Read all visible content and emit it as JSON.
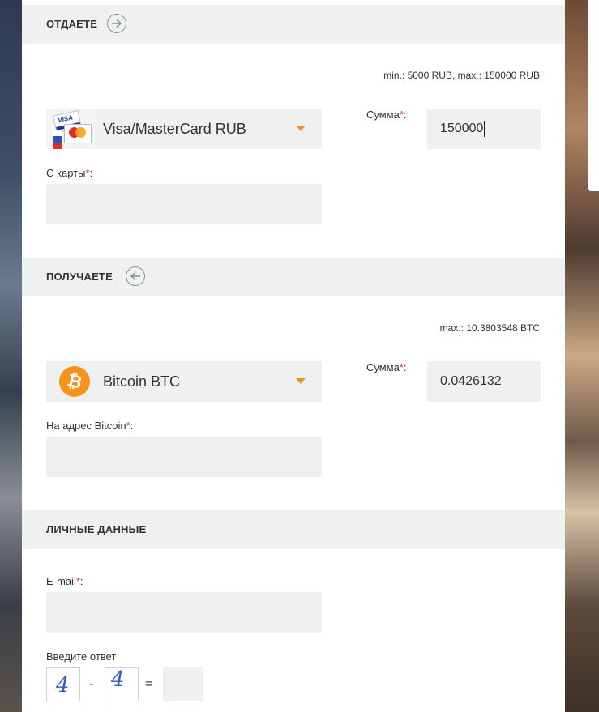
{
  "give": {
    "title": "ОТДАЕТЕ",
    "limits": "min.: 5000 RUB, max.: 150000 RUB",
    "currency": "Visa/MasterCard RUB",
    "currency_icon": "visa-mastercard-icon",
    "sum_label": "Сумма",
    "sum_value": "150000",
    "card_label": "С карты",
    "required_mark": "*",
    "label_colon": ":"
  },
  "receive": {
    "title": "ПОЛУЧАЕТЕ",
    "limits": "max.: 10.3803548 BTC",
    "currency": "Bitcoin BTC",
    "currency_icon": "bitcoin-icon",
    "sum_label": "Сумма",
    "sum_value": "0.0426132",
    "address_label": "На адрес Bitcoin",
    "required_mark": "*",
    "label_colon": ":"
  },
  "personal": {
    "title": "ЛИЧНЫЕ ДАННЫЕ",
    "email_label": "E-mail",
    "required_mark": "*",
    "label_colon": ":",
    "captcha_prompt": "Введите ответ",
    "captcha_a": "4",
    "captcha_op": "-",
    "captcha_b": "4",
    "captcha_eq": "="
  },
  "colors": {
    "accent": "#f39321",
    "required": "#d0363d",
    "field_bg": "#eef1f0"
  }
}
